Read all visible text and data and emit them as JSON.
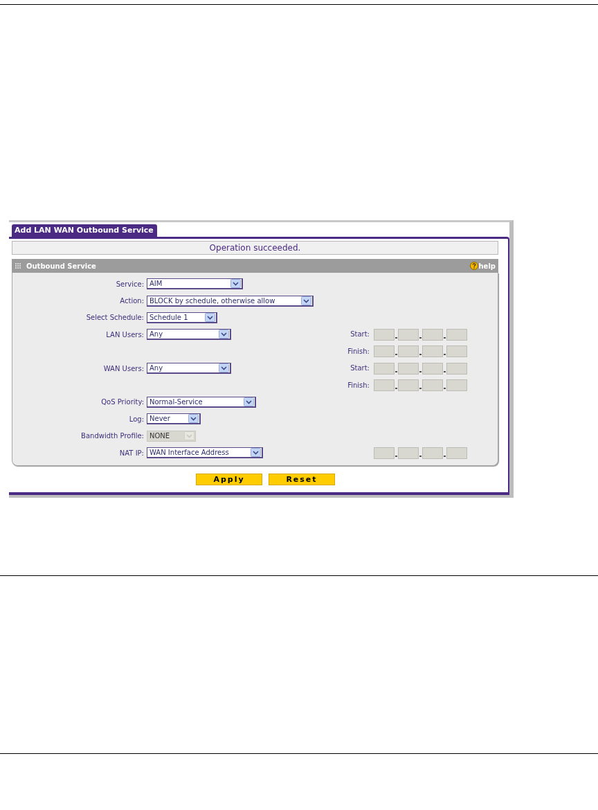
{
  "tab": {
    "label": "Add LAN WAN Outbound Service",
    "selected": true
  },
  "message": "Operation succeeded.",
  "section": {
    "title": "Outbound Service",
    "help": "help"
  },
  "rows": [
    {
      "kind": "select",
      "label": "Service:",
      "value": "AIM",
      "disabled": false
    },
    {
      "kind": "select",
      "label": "Action:",
      "value": "BLOCK by schedule, otherwise allow",
      "disabled": false
    },
    {
      "kind": "select",
      "label": "Select Schedule:",
      "value": "Schedule 1",
      "disabled": false
    },
    {
      "kind": "select_ip",
      "label": "LAN Users:",
      "value": "Any",
      "disabled": false,
      "ip_label": "Start:"
    },
    {
      "kind": "ip",
      "ip_label": "Finish:"
    },
    {
      "kind": "select_ip",
      "label": "WAN Users:",
      "value": "Any",
      "disabled": false,
      "ip_label": "Start:"
    },
    {
      "kind": "ip",
      "ip_label": "Finish:"
    },
    {
      "kind": "select",
      "label": "QoS Priority:",
      "value": "Normal-Service",
      "disabled": false
    },
    {
      "kind": "select",
      "label": "Log:",
      "value": "Never",
      "disabled": false
    },
    {
      "kind": "select",
      "label": "Bandwidth Profile:",
      "value": "NONE",
      "disabled": true
    },
    {
      "kind": "select_ip",
      "label": "NAT IP:",
      "value": "WAN Interface Address",
      "disabled": false
    }
  ],
  "buttons": [
    "Apply",
    "Reset"
  ]
}
